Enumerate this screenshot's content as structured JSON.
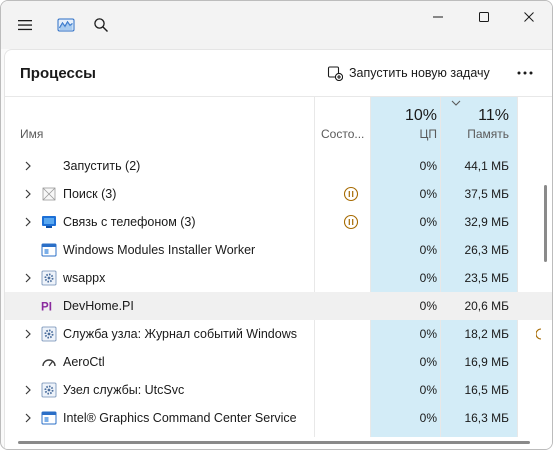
{
  "titlebar": {
    "menu_icon": "hamburger-icon",
    "app_icon": "performance-graph-icon",
    "search_icon": "search-icon",
    "window_controls": [
      "minimize",
      "maximize",
      "close"
    ]
  },
  "header": {
    "title": "Процессы",
    "run_task_label": "Запустить новую задачу",
    "more_icon": "more-horizontal-icon"
  },
  "columns": {
    "name": "Имя",
    "status": "Состо...",
    "cpu_percent": "10%",
    "cpu_label": "ЦП",
    "memory_percent": "11%",
    "memory_label": "Память"
  },
  "processes": [
    {
      "name": "Запустить (2)",
      "expandable": true,
      "icon": "none",
      "status": "",
      "cpu": "0%",
      "memory": "44,1 МБ"
    },
    {
      "name": "Поиск (3)",
      "expandable": true,
      "icon": "search-app-icon",
      "status": "suspended",
      "cpu": "0%",
      "memory": "37,5 МБ"
    },
    {
      "name": "Связь с телефоном (3)",
      "expandable": true,
      "icon": "phone-link-icon",
      "status": "suspended",
      "cpu": "0%",
      "memory": "32,9 МБ"
    },
    {
      "name": "Windows Modules Installer Worker",
      "expandable": false,
      "icon": "window-app-icon",
      "status": "",
      "cpu": "0%",
      "memory": "26,3 МБ"
    },
    {
      "name": "wsappx",
      "expandable": true,
      "icon": "gear-service-icon",
      "status": "",
      "cpu": "0%",
      "memory": "23,5 МБ"
    },
    {
      "name": "DevHome.PI",
      "expandable": false,
      "icon": "pi-icon",
      "status": "",
      "cpu": "0%",
      "memory": "20,6 МБ"
    },
    {
      "name": "Служба узла: Журнал событий Windows",
      "expandable": true,
      "icon": "gear-service-icon",
      "status": "",
      "cpu": "0%",
      "memory": "18,2 МБ"
    },
    {
      "name": "AeroCtl",
      "expandable": false,
      "icon": "gauge-icon",
      "status": "",
      "cpu": "0%",
      "memory": "16,9 МБ"
    },
    {
      "name": "Узел службы: UtcSvc",
      "expandable": true,
      "icon": "gear-service-icon",
      "status": "",
      "cpu": "0%",
      "memory": "16,5 МБ"
    },
    {
      "name": "Intel® Graphics Command Center Service",
      "expandable": true,
      "icon": "window-app-icon",
      "status": "",
      "cpu": "0%",
      "memory": "16,3 МБ"
    }
  ],
  "colors": {
    "accent_blue": "#0067c0",
    "cpu_heat": "#d3ecf7",
    "suspended": "#a66a00",
    "pi_purple": "#8a2a9e"
  }
}
